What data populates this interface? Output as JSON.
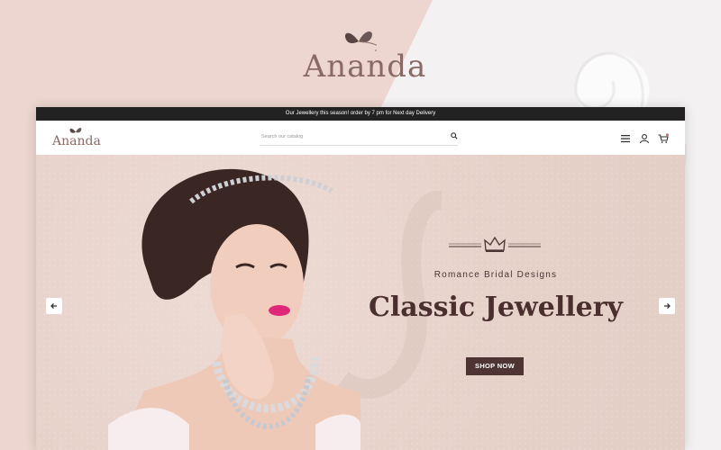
{
  "promo": {
    "logo_text": "Ananda"
  },
  "site": {
    "announcement": "Our Jewellery this season! order by 7 pm for Next day Delivery",
    "logo_text": "Ananda",
    "search": {
      "placeholder": "Search our catalog"
    },
    "header_icons": [
      "menu-icon",
      "user-icon",
      "cart-icon"
    ]
  },
  "hero": {
    "tagline": "Romance Bridal Designs",
    "headline": "Classic Jewellery",
    "cta_label": "SHOP NOW",
    "prev_icon": "arrow-left-icon",
    "next_icon": "arrow-right-icon"
  },
  "colors": {
    "brand": "#8a6a66",
    "accent_dark": "#4f3434",
    "hero_bg": "#e6d1c9"
  }
}
